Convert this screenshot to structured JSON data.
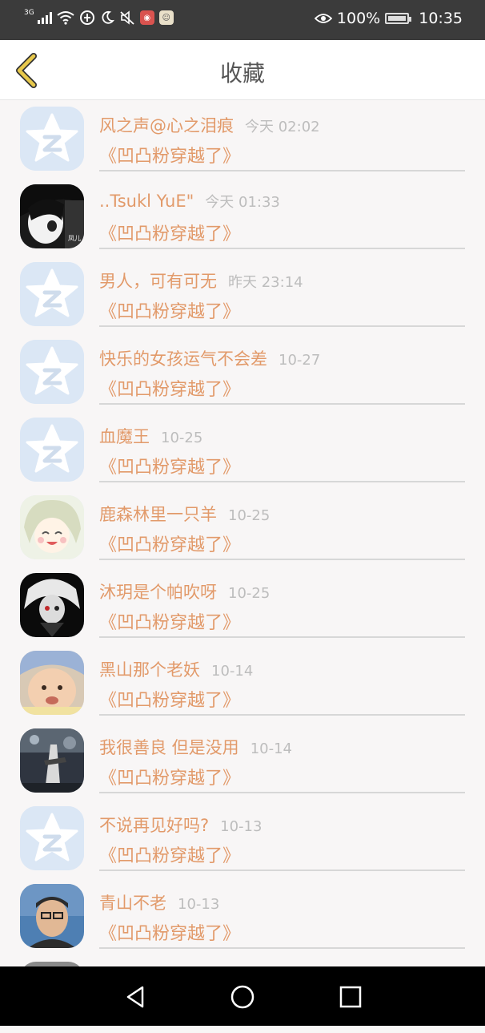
{
  "status_bar": {
    "network": "3G",
    "battery": "100%",
    "time": "10:35"
  },
  "header": {
    "title": "收藏"
  },
  "items": [
    {
      "name": "风之声@心之泪痕",
      "time": "今天 02:02",
      "title": "《凹凸粉穿越了》",
      "avatar": "default"
    },
    {
      "name": "..Tsukl YuE\"",
      "time": "今天 01:33",
      "title": "《凹凸粉穿越了》",
      "avatar": "anime-bw"
    },
    {
      "name": "男人，可有可无",
      "time": "昨天 23:14",
      "title": "《凹凸粉穿越了》",
      "avatar": "default"
    },
    {
      "name": "快乐的女孩运气不会差",
      "time": "10-27",
      "title": "《凹凸粉穿越了》",
      "avatar": "default"
    },
    {
      "name": "血魔王",
      "time": "10-25",
      "title": "《凹凸粉穿越了》",
      "avatar": "default"
    },
    {
      "name": "鹿森林里一只羊",
      "time": "10-25",
      "title": "《凹凸粉穿越了》",
      "avatar": "anime-light"
    },
    {
      "name": "沐玥是个帕吹呀",
      "time": "10-25",
      "title": "《凹凸粉穿越了》",
      "avatar": "anime-dark"
    },
    {
      "name": "黑山那个老妖",
      "time": "10-14",
      "title": "《凹凸粉穿越了》",
      "avatar": "baby"
    },
    {
      "name": "我很善良 但是没用",
      "time": "10-14",
      "title": "《凹凸粉穿越了》",
      "avatar": "photo-dark"
    },
    {
      "name": "不说再见好吗?",
      "time": "10-13",
      "title": "《凹凸粉穿越了》",
      "avatar": "default"
    },
    {
      "name": "青山不老",
      "time": "10-13",
      "title": "《凹凸粉穿越了》",
      "avatar": "man"
    }
  ],
  "colors": {
    "accent": "#e29a6a",
    "back_arrow": "#e7c84b"
  }
}
